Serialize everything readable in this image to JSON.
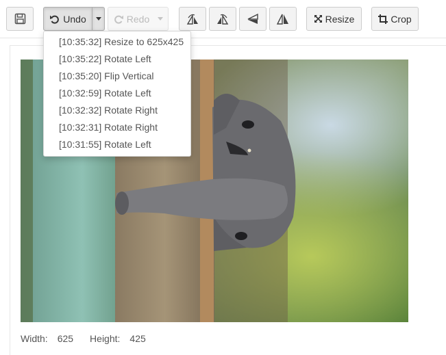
{
  "toolbar": {
    "save_icon": "floppy-disk-icon",
    "undo_label": "Undo",
    "undo_icon": "undo-arrow-icon",
    "redo_label": "Redo",
    "redo_icon": "redo-arrow-icon",
    "rotate_left_icon": "rotate-left-icon",
    "rotate_right_icon": "rotate-right-icon",
    "flip_vertical_icon": "flip-vertical-icon",
    "flip_horizontal_icon": "flip-horizontal-icon",
    "resize_label": "Resize",
    "resize_icon": "resize-arrows-icon",
    "crop_label": "Crop",
    "crop_icon": "crop-icon"
  },
  "history": [
    "[10:35:32] Resize to 625x425",
    "[10:35:22] Rotate Left",
    "[10:35:20] Flip Vertical",
    "[10:32:59] Rotate Left",
    "[10:32:32] Rotate Right",
    "[10:32:31] Rotate Right",
    "[10:31:55] Rotate Left"
  ],
  "image": {
    "subject": "elephant calf behind tree trunk (rotated photo)"
  },
  "info": {
    "width_label": "Width:",
    "width_value": "625",
    "height_label": "Height:",
    "height_value": "425"
  }
}
